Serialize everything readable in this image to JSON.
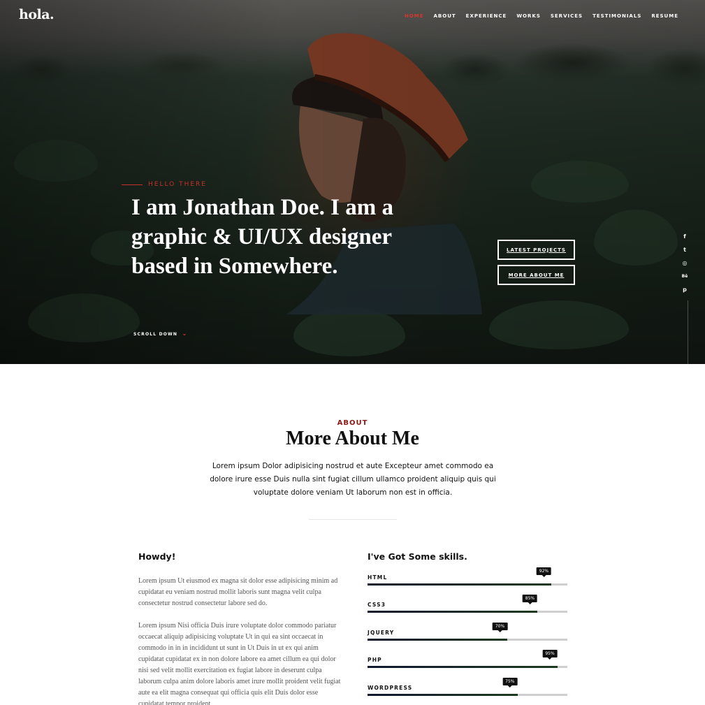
{
  "brand": {
    "logo": "hola."
  },
  "nav": {
    "items": [
      {
        "label": "HOME",
        "active": true
      },
      {
        "label": "ABOUT"
      },
      {
        "label": "EXPERIENCE"
      },
      {
        "label": "WORKS"
      },
      {
        "label": "SERVICES"
      },
      {
        "label": "TESTIMONIALS"
      },
      {
        "label": "RESUME"
      }
    ]
  },
  "hero": {
    "kicker": "HELLO THERE",
    "headline": "I am Jonathan Doe. I am a graphic & UI/UX designer based in Somewhere.",
    "buttons": {
      "primary": "LATEST PROJECTS",
      "secondary": "MORE ABOUT ME"
    },
    "scroll_label": "SCROLL DOWN",
    "social": [
      "facebook-icon",
      "twitter-icon",
      "instagram-icon",
      "behance-icon",
      "pinterest-icon"
    ],
    "social_glyphs": [
      "f",
      "t",
      "◎",
      "Bē",
      "p"
    ]
  },
  "about": {
    "kicker": "ABOUT",
    "title": "More About Me",
    "lead": "Lorem ipsum Dolor adipisicing nostrud et aute Excepteur amet commodo ea dolore irure esse Duis nulla sint fugiat cillum ullamco proident aliquip quis qui voluptate dolore veniam Ut laborum non est in officia.",
    "howdy_title": "Howdy!",
    "paragraph_1": "Lorem ipsum Ut eiusmod ex magna sit dolor esse adipisicing minim ad cupidatat eu veniam nostrud mollit laboris sunt magna velit culpa consectetur nostrud consectetur labore sed do.",
    "paragraph_2": "Lorem ipsum Nisi officia Duis irure voluptate dolor commodo pariatur occaecat aliquip adipisicing voluptate Ut in qui ea sint occaecat in commodo in in in incididunt ut sunt in Ut Duis in ut ex qui anim cupidatat cupidatat ex in non dolore labore ea amet cillum ea qui dolor nisi sed velit mollit exercitation ex fugiat labore in deserunt culpa laborum culpa anim dolore laboris amet irure mollit proident velit fugiat aute ea elit magna consequat qui officia quis elit Duis dolor esse cupidatat tempor proident",
    "skills_title": "I've Got Some skills.",
    "skills": [
      {
        "name": "HTML",
        "percent": 92,
        "label": "92%"
      },
      {
        "name": "CSS3",
        "percent": 85,
        "label": "85%"
      },
      {
        "name": "JQUERY",
        "percent": 70,
        "label": "70%"
      },
      {
        "name": "PHP",
        "percent": 95,
        "label": "95%"
      },
      {
        "name": "WORDPRESS",
        "percent": 75,
        "label": "75%"
      }
    ]
  },
  "colors": {
    "accent": "#d7362d",
    "kicker": "#8b1a17",
    "bar_fill": "#0f1730",
    "bar_track": "#cfcfcf"
  }
}
